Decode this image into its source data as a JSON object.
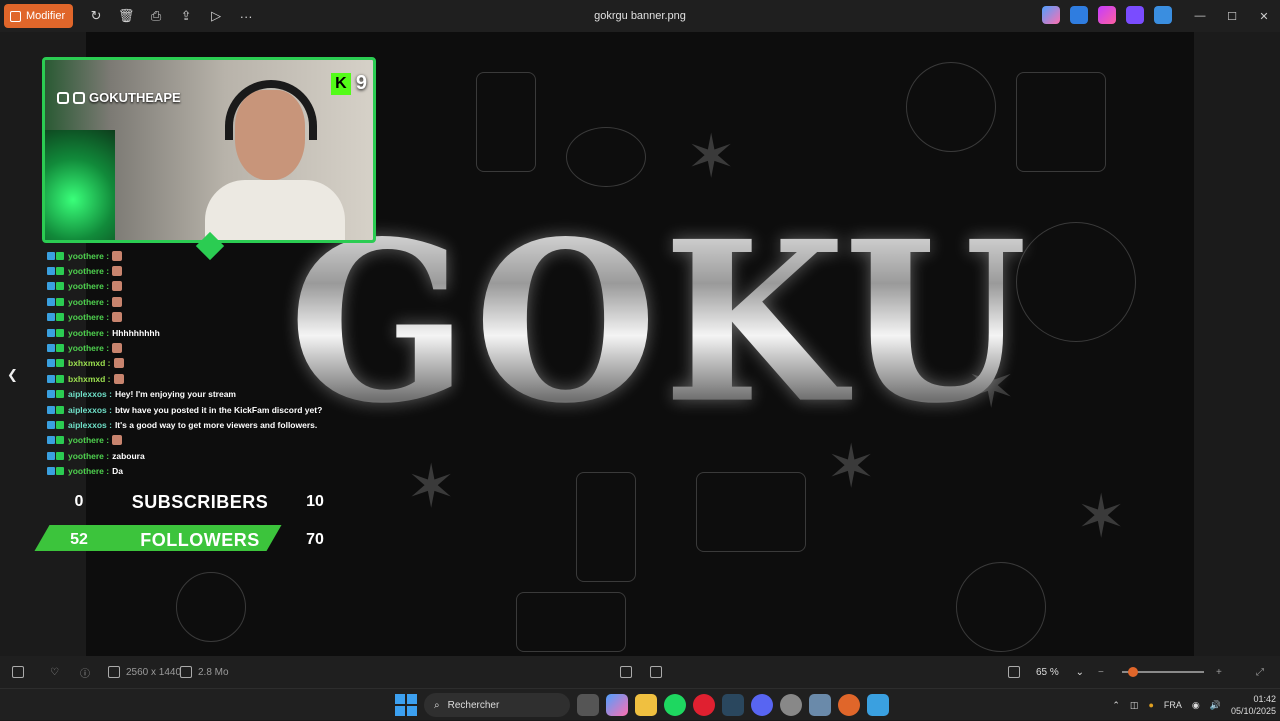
{
  "titlebar": {
    "edit_label": "Modifier",
    "file_title": "gokrgu banner.png",
    "actions": [
      "rotate-icon",
      "delete-icon",
      "print-icon",
      "share-icon",
      "slideshow-icon",
      "more-icon"
    ]
  },
  "stream": {
    "handle": "GOKUTHEAPE",
    "viewer_count": "9",
    "logo": "GOKU"
  },
  "chat": [
    {
      "user": "yoothere",
      "msg": "",
      "emote": true,
      "color": "#4fd24f"
    },
    {
      "user": "yoothere",
      "msg": "",
      "emote": true,
      "color": "#4fd24f"
    },
    {
      "user": "yoothere",
      "msg": "",
      "emote": true,
      "color": "#4fd24f"
    },
    {
      "user": "yoothere",
      "msg": "",
      "emote": true,
      "color": "#4fd24f"
    },
    {
      "user": "yoothere",
      "msg": "",
      "emote": true,
      "color": "#4fd24f"
    },
    {
      "user": "yoothere",
      "msg": "Hhhhhhhhh",
      "emote": false,
      "color": "#4fd24f"
    },
    {
      "user": "yoothere",
      "msg": "",
      "emote": true,
      "color": "#4fd24f"
    },
    {
      "user": "bxhxmxd",
      "msg": "",
      "emote": true,
      "color": "#9be04f"
    },
    {
      "user": "bxhxmxd",
      "msg": "",
      "emote": true,
      "color": "#9be04f"
    },
    {
      "user": "aiplexxos",
      "msg": "Hey! I'm enjoying your stream",
      "emote": false,
      "color": "#6fe0c8"
    },
    {
      "user": "aiplexxos",
      "msg": "btw have you posted it in the KickFam discord yet?",
      "emote": false,
      "color": "#6fe0c8"
    },
    {
      "user": "aiplexxos",
      "msg": "It's a good way to get more viewers and followers.",
      "emote": false,
      "color": "#6fe0c8"
    },
    {
      "user": "yoothere",
      "msg": "",
      "emote": true,
      "color": "#4fd24f"
    },
    {
      "user": "yoothere",
      "msg": "zaboura",
      "emote": false,
      "color": "#4fd24f"
    },
    {
      "user": "yoothere",
      "msg": "Da",
      "emote": false,
      "color": "#4fd24f"
    }
  ],
  "stats": {
    "subs_current": "0",
    "subs_label": "SUBSCRIBERS",
    "subs_goal": "10",
    "followers_current": "52",
    "followers_label": "FOLLOWERS",
    "followers_goal": "70"
  },
  "statusbar": {
    "dimensions": "2560 x 1440",
    "filesize": "2.8 Mo",
    "zoom": "65 %"
  },
  "taskbar": {
    "search_placeholder": "Rechercher",
    "language": "FRA",
    "time": "01:42",
    "date": "05/10/2025"
  },
  "colors": {
    "accent": "#e0662a",
    "kick_green": "#53fc18",
    "overlay_green": "#2bcc52"
  }
}
